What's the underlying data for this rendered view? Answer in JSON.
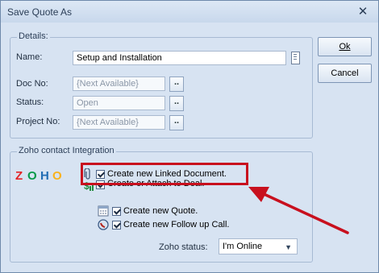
{
  "window": {
    "title": "Save Quote As",
    "close_glyph": "✕"
  },
  "details": {
    "legend": "Details:",
    "name_label": "Name:",
    "name_value": "Setup and Installation",
    "doc_label": "Doc No:",
    "doc_value": "{Next Available}",
    "status_label": "Status:",
    "status_value": "Open",
    "project_label": "Project No:",
    "project_value": "{Next Available}",
    "browse_label": ".."
  },
  "buttons": {
    "ok": "Ok",
    "cancel": "Cancel"
  },
  "zoho": {
    "legend": "Zoho contact Integration",
    "logo_letters": [
      "Z",
      "O",
      "H",
      "O"
    ],
    "logo_colors": [
      "#e42527",
      "#089949",
      "#226db4",
      "#f9b21d"
    ],
    "linked_doc": "Create new Linked Document.",
    "attach_deal": "Create or Attach to Deal.",
    "new_quote": "Create new Quote.",
    "follow_up": "Create new Follow up Call.",
    "status_label": "Zoho status:",
    "status_value": "I'm Online"
  },
  "colors": {
    "highlight": "#c8101e",
    "arrow": "#c8101e"
  },
  "icons": [
    "close-icon",
    "notes-icon",
    "paperclip-icon",
    "money-icon",
    "calendar-icon",
    "phone-icon",
    "dropdown-arrow-icon"
  ]
}
